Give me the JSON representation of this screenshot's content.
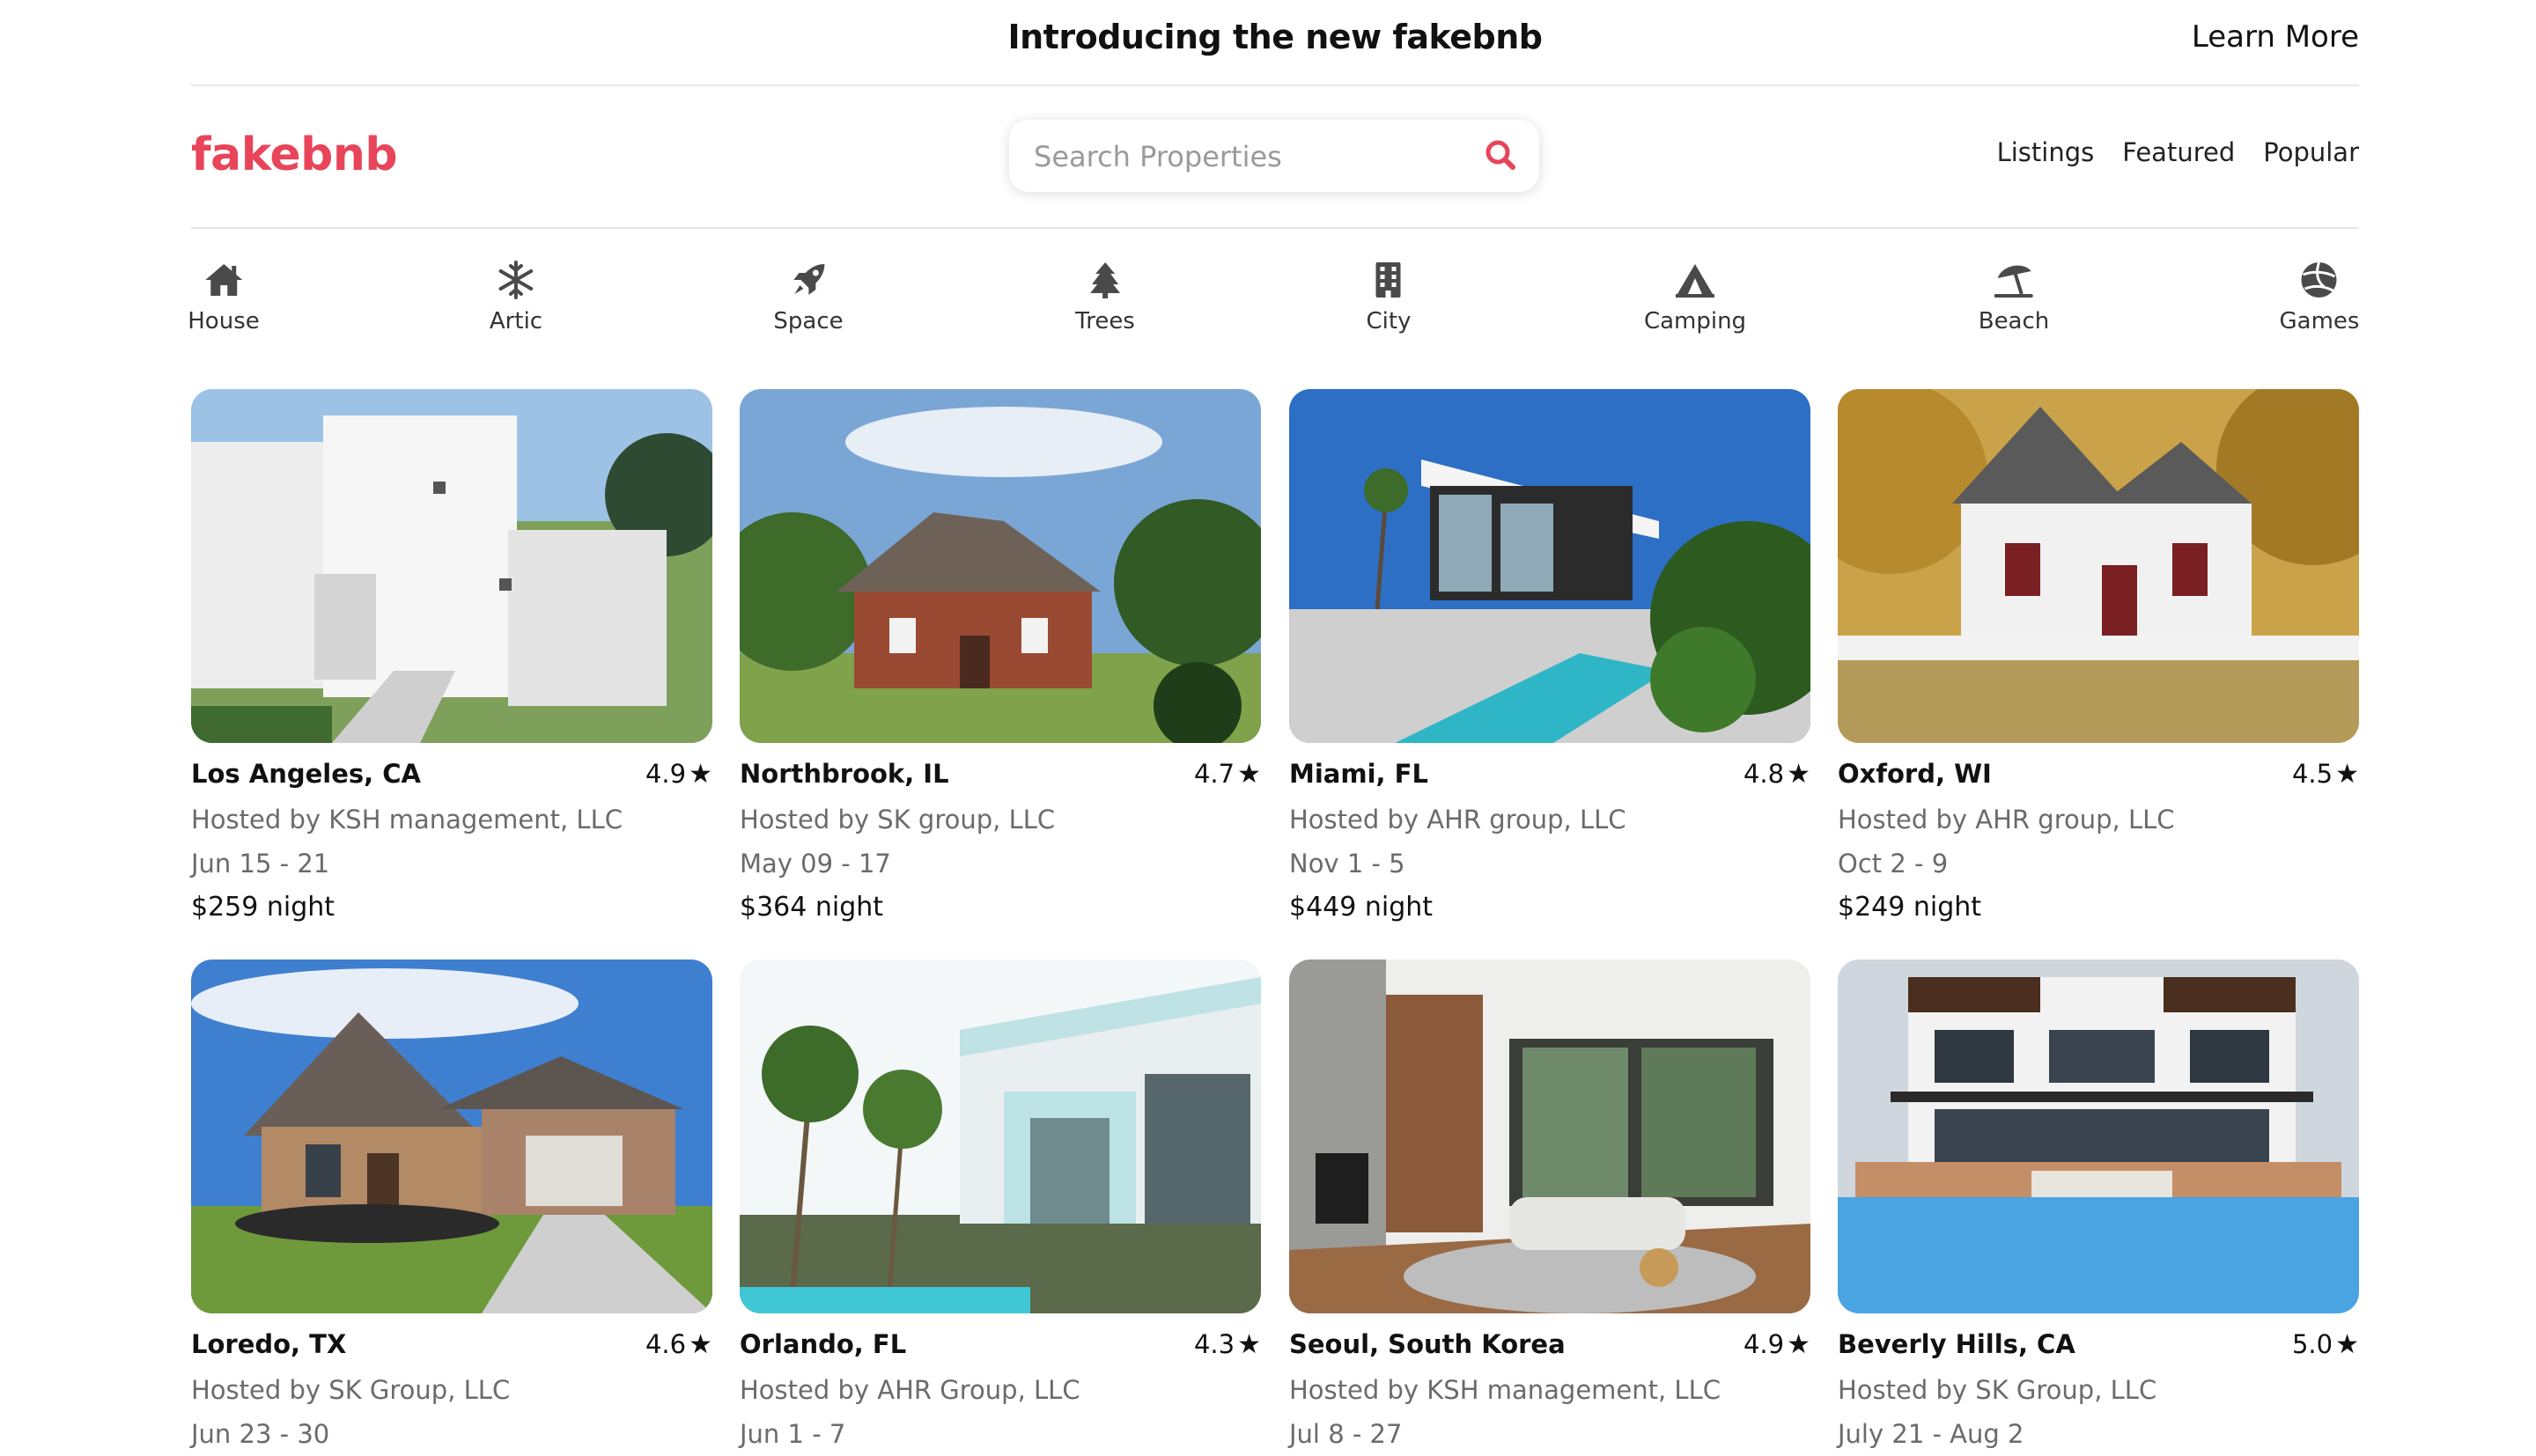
{
  "announcement": {
    "title": "Introducing the new fakebnb",
    "learn_more": "Learn More"
  },
  "header": {
    "logo": "fakebnb",
    "search_placeholder": "Search Properties",
    "nav": [
      "Listings",
      "Featured",
      "Popular"
    ]
  },
  "categories": [
    {
      "label": "House",
      "icon": "house-icon"
    },
    {
      "label": "Artic",
      "icon": "snowflake-icon"
    },
    {
      "label": "Space",
      "icon": "rocket-icon"
    },
    {
      "label": "Trees",
      "icon": "tree-icon"
    },
    {
      "label": "City",
      "icon": "building-icon"
    },
    {
      "label": "Camping",
      "icon": "tent-icon"
    },
    {
      "label": "Beach",
      "icon": "umbrella-icon"
    },
    {
      "label": "Games",
      "icon": "volleyball-icon"
    }
  ],
  "listings": [
    {
      "location": "Los Angeles, CA",
      "rating": "4.9",
      "host": "Hosted by KSH management, LLC",
      "dates": "Jun 15 - 21",
      "price": "$259 night"
    },
    {
      "location": "Northbrook, IL",
      "rating": "4.7",
      "host": "Hosted by SK group, LLC",
      "dates": "May 09 - 17",
      "price": "$364 night"
    },
    {
      "location": "Miami, FL",
      "rating": "4.8",
      "host": "Hosted by AHR group, LLC",
      "dates": "Nov 1 - 5",
      "price": "$449 night"
    },
    {
      "location": "Oxford, WI",
      "rating": "4.5",
      "host": "Hosted by AHR group, LLC",
      "dates": "Oct 2 - 9",
      "price": "$249 night"
    },
    {
      "location": "Loredo, TX",
      "rating": "4.6",
      "host": "Hosted by SK Group, LLC",
      "dates": "Jun 23 - 30",
      "price": ""
    },
    {
      "location": "Orlando, FL",
      "rating": "4.3",
      "host": "Hosted by AHR Group, LLC",
      "dates": "Jun 1 - 7",
      "price": ""
    },
    {
      "location": "Seoul, South Korea",
      "rating": "4.9",
      "host": "Hosted by KSH management, LLC",
      "dates": "Jul 8 - 27",
      "price": ""
    },
    {
      "location": "Beverly Hills, CA",
      "rating": "5.0",
      "host": "Hosted by SK Group, LLC",
      "dates": "July 21 - Aug 2",
      "price": ""
    }
  ],
  "colors": {
    "brand": "#e8445a",
    "icon": "#4a4a4a",
    "muted_text": "#6b6b6b"
  }
}
